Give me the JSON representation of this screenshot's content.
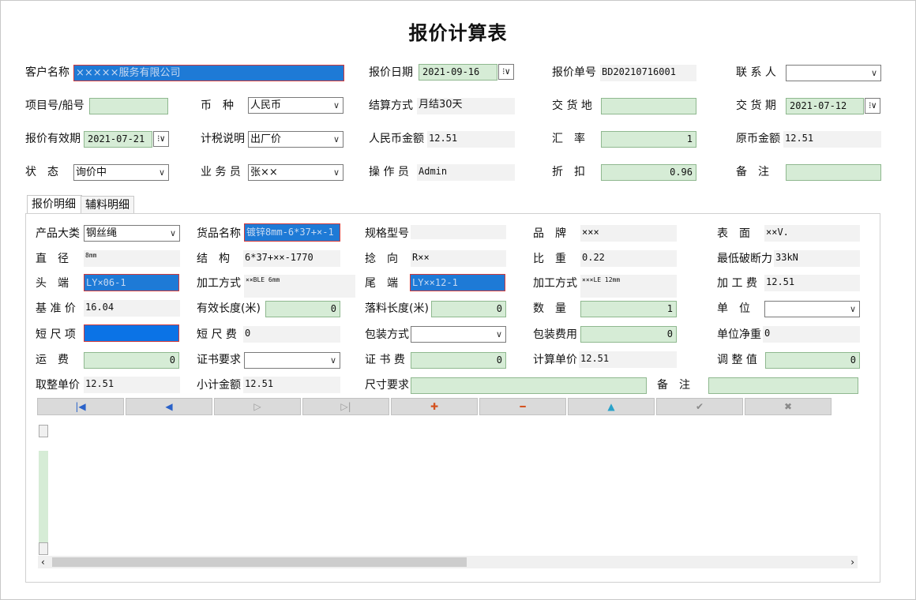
{
  "title": "报价计算表",
  "header": {
    "customer_label": "客户名称",
    "customer_value": "×××××服务有限公司",
    "quote_date_label": "报价日期",
    "quote_date": "2021-09-16",
    "quote_no_label": "报价单号",
    "quote_no": "BD20210716001",
    "contact_label": "联 系 人",
    "contact_value": "",
    "project_label": "项目号/船号",
    "project_value": "",
    "currency_label": "币　种",
    "currency_value": "人民币",
    "settle_label": "结算方式",
    "settle_value": "月结30天",
    "delivery_place_label": "交 货 地",
    "delivery_place_value": "",
    "delivery_date_label": "交 货 期",
    "delivery_date": "2021-07-12",
    "valid_label": "报价有效期",
    "valid_date": "2021-07-21",
    "tax_label": "计税说明",
    "tax_value": "出厂价",
    "rmb_label": "人民币金额",
    "rmb_value": "12.51",
    "rate_label": "汇　率",
    "rate_value": "1",
    "orig_label": "原币金额",
    "orig_value": "12.51",
    "status_label": "状　态",
    "status_value": "询价中",
    "sales_label": "业 务 员",
    "sales_value": "张××",
    "operator_label": "操 作 员",
    "operator_value": "Admin",
    "discount_label": "折　扣",
    "discount_value": "0.96",
    "remark_label": "备　注",
    "remark_value": ""
  },
  "tabs": [
    "报价明细",
    "辅料明细"
  ],
  "detail": {
    "category_label": "产品大类",
    "category_value": "钢丝绳",
    "goods_label": "货品名称",
    "goods_value": "镀锌8mm-6*37+×-1",
    "spec_label": "规格型号",
    "spec_value": "",
    "brand_label": "品　牌",
    "brand_value": "×××",
    "surface_label": "表　面",
    "surface_value": "××V.",
    "diameter_label": "直　径",
    "diameter_value": "8mm",
    "structure_label": "结　构",
    "structure_value": "6*37+××-1770",
    "twist_label": "捻　向",
    "twist_value": "R××",
    "weight_label": "比　重",
    "weight_value": "0.22",
    "breaking_label": "最低破断力",
    "breaking_value": "33kN",
    "head_label": "头　端",
    "head_value": "LY×06-1",
    "process1_label": "加工方式",
    "process1_value": "××BLE 6mm",
    "tail_label": "尾　端",
    "tail_value": "LY××12-1",
    "process2_label": "加工方式",
    "process2_value": "×××LE 12mm",
    "process_fee_label": "加 工 费",
    "process_fee_value": "12.51",
    "base_price_label": "基 准 价",
    "base_price_value": "16.04",
    "eff_len_label": "有效长度(米)",
    "eff_len_value": "0",
    "cut_len_label": "落料长度(米)",
    "cut_len_value": "0",
    "qty_label": "数　量",
    "qty_value": "1",
    "unit_label": "单　位",
    "unit_value": "",
    "short_item_label": "短 尺 项",
    "short_item_value": "",
    "short_fee_label": "短 尺 费",
    "short_fee_value": "0",
    "pack_label": "包装方式",
    "pack_value": "",
    "pack_fee_label": "包装费用",
    "pack_fee_value": "0",
    "net_weight_label": "单位净重",
    "net_weight_value": "0",
    "freight_label": "运　费",
    "freight_value": "0",
    "cert_req_label": "证书要求",
    "cert_req_value": "",
    "cert_fee_label": "证 书 费",
    "cert_fee_value": "0",
    "calc_price_label": "计算单价",
    "calc_price_value": "12.51",
    "adjust_label": "调 整 值",
    "adjust_value": "0",
    "round_price_label": "取整单价",
    "round_price_value": "12.51",
    "subtotal_label": "小计金额",
    "subtotal_value": "12.51",
    "size_req_label": "尺寸要求",
    "size_req_value": "",
    "remark2_label": "备　注",
    "remark2_value": ""
  },
  "navigator": [
    "first",
    "prior",
    "next",
    "last",
    "insert",
    "delete",
    "edit",
    "post",
    "cancel"
  ],
  "icons": {
    "first": "|◀",
    "prior": "◀",
    "next": "▷",
    "last": "▷|",
    "insert": "✚",
    "delete": "━",
    "edit": "▲",
    "post": "✔",
    "cancel": "✖"
  },
  "colors": {
    "field_green": "#d6ecd6",
    "highlight_blue": "#1e7ad6",
    "readonly_gray": "#f2f2f2",
    "required_border": "#d23a3a"
  }
}
